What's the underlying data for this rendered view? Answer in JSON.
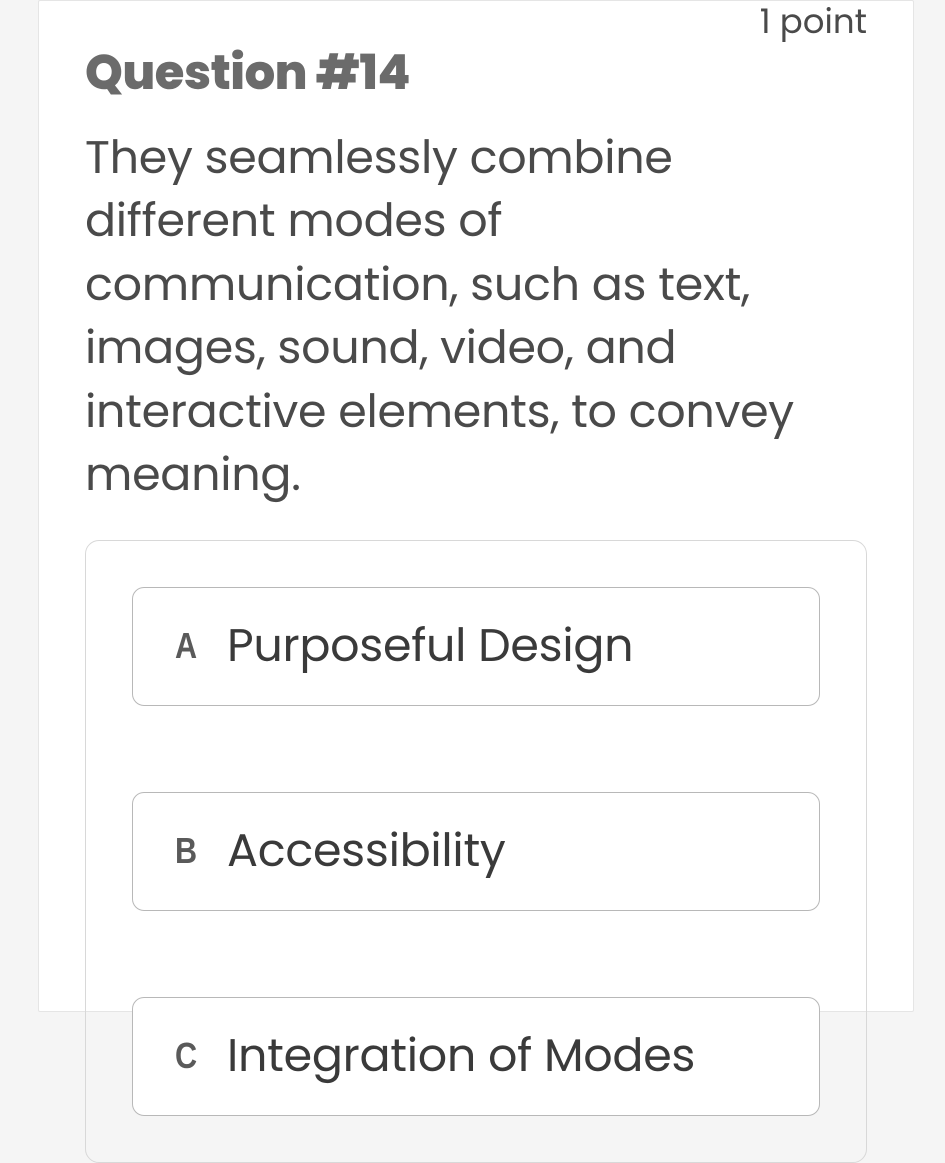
{
  "question": {
    "points_label": "1 point",
    "title": "Question #14",
    "prompt": "They seamlessly combine different modes of communication, such as text, images, sound, video, and interactive elements, to convey meaning.",
    "options": [
      {
        "letter": "A",
        "text": "Purposeful Design"
      },
      {
        "letter": "B",
        "text": "Accessibility"
      },
      {
        "letter": "C",
        "text": "Integration of Modes"
      }
    ]
  }
}
